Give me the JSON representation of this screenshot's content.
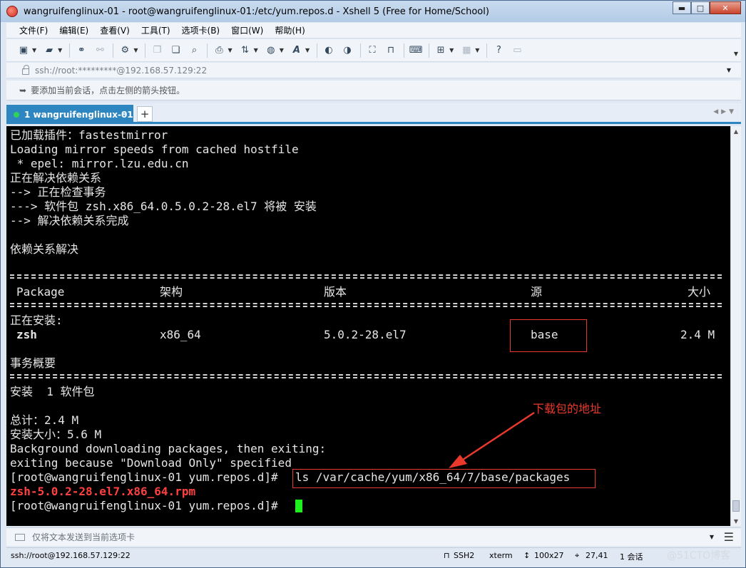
{
  "window": {
    "title": "wangruifenglinux-01 - root@wangruifenglinux-01:/etc/yum.repos.d - Xshell 5 (Free for Home/School)",
    "controls": {
      "minimize": "▬",
      "maximize": "□",
      "close": "✕"
    }
  },
  "menu": [
    "文件(F)",
    "编辑(E)",
    "查看(V)",
    "工具(T)",
    "选项卡(B)",
    "窗口(W)",
    "帮助(H)"
  ],
  "toolbar": {
    "icons": [
      "new-session-icon",
      "open-folder-icon",
      "connect-icon",
      "disconnect-icon",
      "properties-icon",
      "copy-icon",
      "paste-icon",
      "find-icon",
      "print-icon",
      "transfer-icon",
      "globe-icon",
      "font-icon",
      "xftp-icon",
      "xmanager-icon",
      "fullscreen-icon",
      "lock-icon",
      "keyboard-icon",
      "new-tab-icon",
      "layout-icon",
      "help-icon",
      "chat-icon"
    ]
  },
  "address": {
    "text": "ssh://root:*********@192.168.57.129:22"
  },
  "hint": {
    "text": "要添加当前会话，点击左侧的箭头按钮。"
  },
  "tab": {
    "label": "1 wangruifenglinux-01",
    "close": "×",
    "add": "+"
  },
  "terminal": {
    "lines": [
      "已加载插件：fastestmirror",
      "Loading mirror speeds from cached hostfile",
      " * epel: mirror.lzu.edu.cn",
      "正在解决依赖关系",
      "--> 正在检查事务",
      "---> 软件包 zsh.x86_64.0.5.0.2-28.el7 将被 安装",
      "--> 解决依赖关系完成",
      "",
      "依赖关系解决"
    ],
    "table_header": {
      "package": "Package",
      "arch": "架构",
      "version": "版本",
      "repo": "源",
      "size": "大小"
    },
    "installing_label": "正在安装:",
    "row": {
      "package": "zsh",
      "arch": "x86_64",
      "version": "5.0.2-28.el7",
      "repo": "base",
      "size": "2.4 M"
    },
    "summary_title": "事务概要",
    "install_line": "安装  1 软件包",
    "total": "总计：2.4 M",
    "installed_size": "安装大小：5.6 M",
    "bg_line": "Background downloading packages, then exiting:",
    "exit_line": "exiting because \"Download Only\" specified",
    "prompt": "[root@wangruifenglinux-01 yum.repos.d]# ",
    "command": "ls /var/cache/yum/x86_64/7/base/packages",
    "output_file": "zsh-5.0.2-28.el7.x86_64.rpm",
    "prompt2": "[root@wangruifenglinux-01 yum.repos.d]# "
  },
  "annotation": {
    "text": "下载包的地址",
    "color": "#e8392c"
  },
  "compose": {
    "placeholder": "仅将文本发送到当前选项卡"
  },
  "status": {
    "connection": "ssh://root@192.168.57.129:22",
    "protocol": "SSH2",
    "term": "xterm",
    "size": "100x27",
    "cursor": "27,41",
    "sessions": "1 会话"
  },
  "watermark": "@51CTO博客"
}
